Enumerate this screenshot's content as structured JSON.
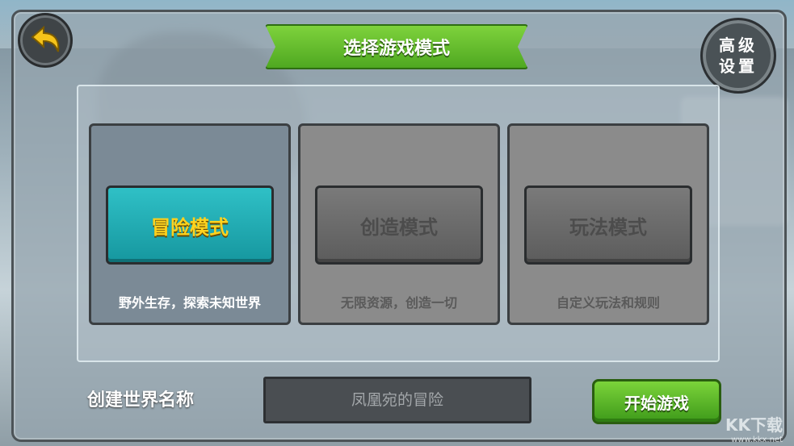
{
  "title": "选择游戏模式",
  "advanced_settings": "高级\n设置",
  "modes": [
    {
      "label": "冒险模式",
      "description": "野外生存，探索未知世界",
      "state": "selected"
    },
    {
      "label": "创造模式",
      "description": "无限资源，创造一切",
      "state": "locked"
    },
    {
      "label": "玩法模式",
      "description": "自定义玩法和规则",
      "state": "locked"
    }
  ],
  "world_name": {
    "label": "创建世界名称",
    "value": "凤凰宛的冒险"
  },
  "start_button": "开始游戏",
  "watermark": {
    "text": "KK下载",
    "url": "www.kkx.net"
  },
  "colors": {
    "accent_teal": "#1fb0b7",
    "accent_green": "#5cb82a",
    "mode_text_yellow": "#ffd21e"
  }
}
